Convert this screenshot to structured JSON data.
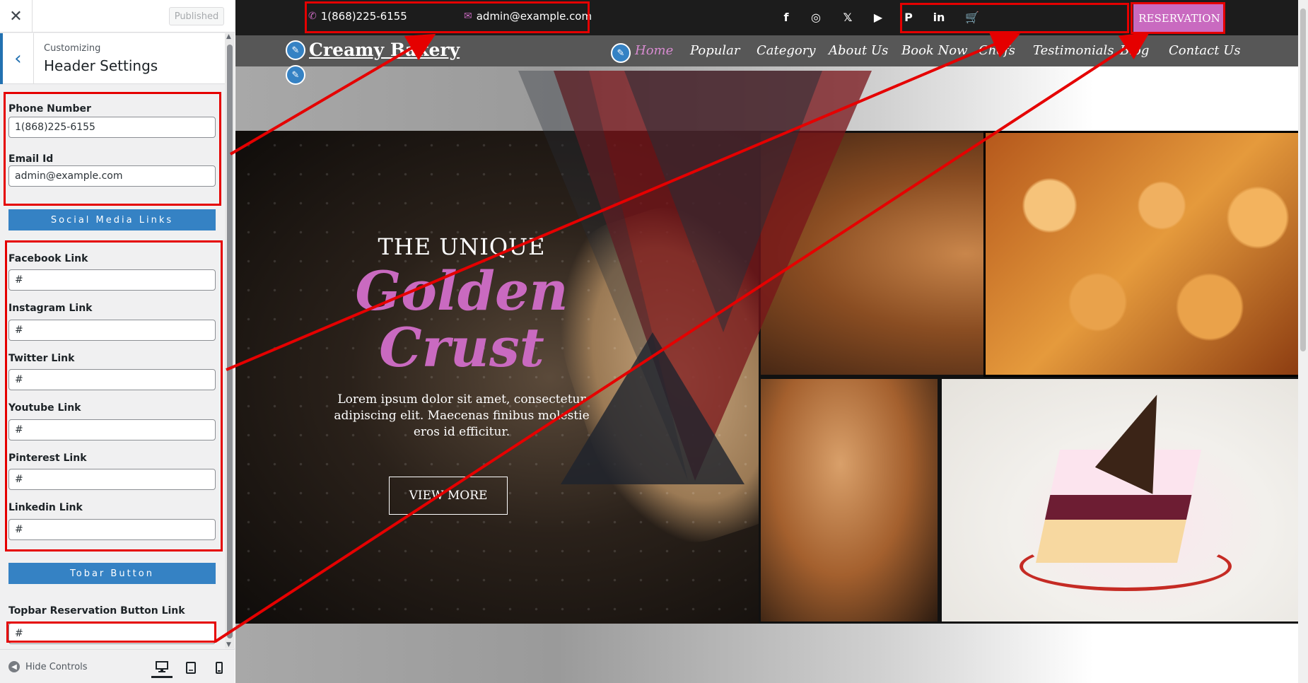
{
  "customizer": {
    "close_label": "✕",
    "publish_label": "Published",
    "breadcrumb": "Customizing",
    "title": "Header Settings",
    "fields": {
      "phone": {
        "label": "Phone Number",
        "value": "1(868)225-6155"
      },
      "email": {
        "label": "Email Id",
        "value": "admin@example.com"
      },
      "social_section": "Social Media Links",
      "facebook": {
        "label": "Facebook Link",
        "value": "#"
      },
      "instagram": {
        "label": "Instagram Link",
        "value": "#"
      },
      "twitter": {
        "label": "Twitter Link",
        "value": "#"
      },
      "youtube": {
        "label": "Youtube Link",
        "value": "#"
      },
      "pinterest": {
        "label": "Pinterest Link",
        "value": "#"
      },
      "linkedin": {
        "label": "Linkedin Link",
        "value": "#"
      },
      "topbar_section": "Tobar Button",
      "reservation_link": {
        "label": "Topbar Reservation Button Link",
        "value": "#"
      }
    },
    "footer": {
      "hide_controls": "Hide Controls"
    }
  },
  "site": {
    "topbar": {
      "phone": "1(868)225-6155",
      "email": "admin@example.com",
      "social": {
        "facebook": "f",
        "instagram": "◎",
        "twitter": "𝕏",
        "youtube": "▶",
        "pinterest": "P",
        "linkedin": "in",
        "cart": "🛒"
      },
      "reservation_label": "RESERVATION"
    },
    "logo": "Creamy Bakery",
    "nav": [
      "Home",
      "Popular",
      "Category",
      "About Us",
      "Book Now",
      "Chefs",
      "Testimonials",
      "Blog",
      "Contact Us"
    ],
    "hero": {
      "subtitle": "THE UNIQUE",
      "title_line1": "Golden",
      "title_line2": "Crust",
      "description": "Lorem ipsum dolor sit amet, consectetur adipiscing elit. Maecenas finibus molestie eros id efficitur.",
      "button_label": "VIEW MORE"
    }
  },
  "colors": {
    "accent_pink": "#c96ac0",
    "wp_blue": "#3582c4",
    "annotation_red": "#e50000",
    "topbar_bg": "#1c1c1c",
    "nav_bg": "#575757"
  }
}
